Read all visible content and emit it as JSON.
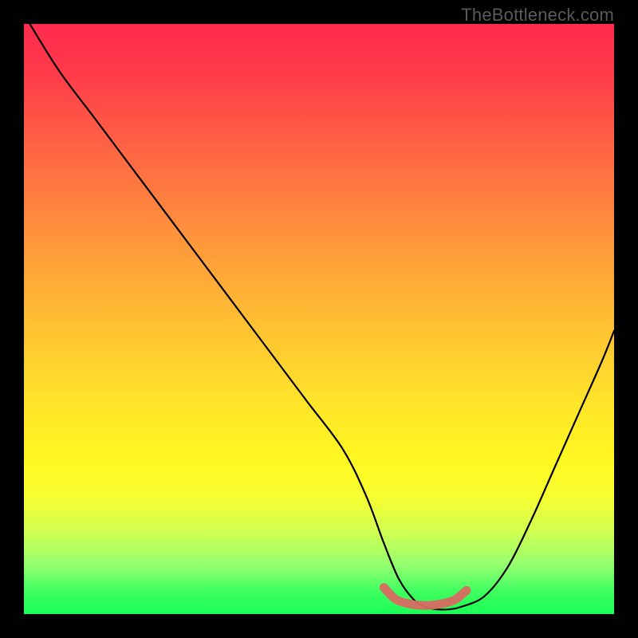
{
  "watermark": "TheBottleneck.com",
  "chart_data": {
    "type": "line",
    "title": "",
    "xlabel": "",
    "ylabel": "",
    "xlim": [
      0,
      100
    ],
    "ylim": [
      0,
      100
    ],
    "series": [
      {
        "name": "bottleneck-curve",
        "x": [
          1,
          6,
          12,
          18,
          24,
          30,
          36,
          42,
          48,
          54,
          58,
          61,
          63.5,
          66,
          68,
          70,
          72,
          74,
          78,
          82,
          86,
          90,
          94,
          98,
          100
        ],
        "y": [
          100,
          92,
          84,
          76,
          68,
          60,
          52,
          44,
          36,
          28,
          20,
          12,
          6,
          2.5,
          1.2,
          0.8,
          0.8,
          1.2,
          3,
          8,
          16,
          25,
          34,
          43,
          48
        ]
      },
      {
        "name": "highlight-band",
        "x": [
          61,
          63,
          65,
          67,
          69,
          71,
          73,
          75
        ],
        "y": [
          4.5,
          2.5,
          1.8,
          1.5,
          1.5,
          1.8,
          2.4,
          4.0
        ]
      }
    ],
    "gradient_stops": [
      {
        "pos": 0,
        "color": "#ff2b4d"
      },
      {
        "pos": 50,
        "color": "#ffd42e"
      },
      {
        "pos": 100,
        "color": "#1aff56"
      }
    ]
  }
}
